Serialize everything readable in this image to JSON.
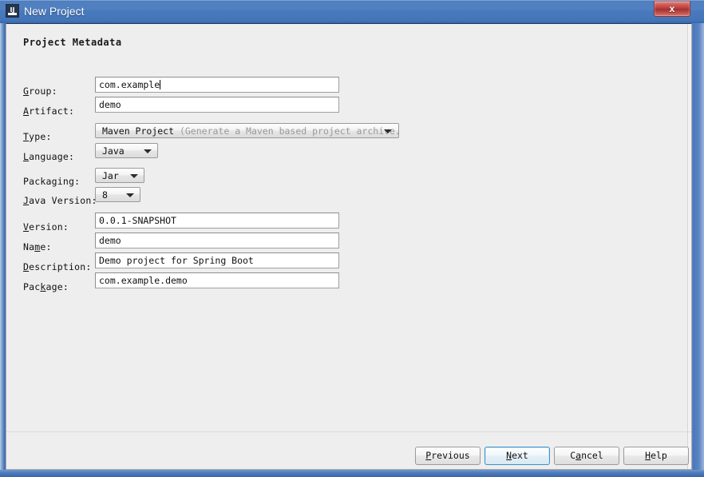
{
  "window": {
    "title": "New Project",
    "icon": "intellij-idea-icon",
    "close_label": "x",
    "titlebar_color": "#4a7abd",
    "content_bg": "#eeeeee"
  },
  "panel": {
    "heading": "Project Metadata"
  },
  "form": {
    "rows": [
      {
        "label": "Group:",
        "mnemonic": "G",
        "value": "com.example",
        "kind": "text",
        "focused": true
      },
      {
        "label": "Artifact:",
        "mnemonic": "A",
        "value": "demo",
        "kind": "text",
        "focused": false
      },
      {
        "label": "Type:",
        "mnemonic": "T",
        "value": "Maven Project",
        "hint": "(Generate a Maven based project archive.)",
        "kind": "combo"
      },
      {
        "label": "Language:",
        "mnemonic": "L",
        "value": "Java",
        "kind": "combo"
      },
      {
        "label": "Packaging:",
        "mnemonic": "",
        "value": "Jar",
        "kind": "combo"
      },
      {
        "label": "Java Version:",
        "mnemonic": "J",
        "value": "8",
        "kind": "combo"
      },
      {
        "label": "Version:",
        "mnemonic": "V",
        "value": "0.0.1-SNAPSHOT",
        "kind": "text",
        "focused": false
      },
      {
        "label": "Name:",
        "mnemonic": "m",
        "value": "demo",
        "kind": "text",
        "focused": false
      },
      {
        "label": "Description:",
        "mnemonic": "D",
        "value": "Demo project for Spring Boot",
        "kind": "text",
        "focused": false
      },
      {
        "label": "Package:",
        "mnemonic": "k",
        "value": "com.example.demo",
        "kind": "text",
        "focused": false
      }
    ],
    "labels": {
      "group_pre": "",
      "group_mn": "G",
      "group_post": "roup:",
      "artifact_pre": "",
      "artifact_mn": "A",
      "artifact_post": "rtifact:",
      "type_pre": "",
      "type_mn": "T",
      "type_post": "ype:",
      "language_pre": "",
      "language_mn": "L",
      "language_post": "anguage:",
      "packaging_full": "Packaging:",
      "javaversion_pre": "",
      "javaversion_mn": "J",
      "javaversion_post": "ava Version:",
      "version_pre": "",
      "version_mn": "V",
      "version_post": "ersion:",
      "name_pre": "Na",
      "name_mn": "m",
      "name_post": "e:",
      "description_pre": "",
      "description_mn": "D",
      "description_post": "escription:",
      "package_pre": "Pac",
      "package_mn": "k",
      "package_post": "age:"
    },
    "values": {
      "group": "com.example",
      "artifact": "demo",
      "type_main": "Maven Project",
      "type_hint": "(Generate a Maven based project archive.)",
      "language": "Java",
      "packaging": "Jar",
      "java_version": "8",
      "version": "0.0.1-SNAPSHOT",
      "name": "demo",
      "description": "Demo project for Spring Boot",
      "package": "com.example.demo"
    }
  },
  "buttons": {
    "previous": {
      "pre": "",
      "mn": "P",
      "post": "revious"
    },
    "next": {
      "pre": "",
      "mn": "N",
      "post": "ext"
    },
    "cancel": {
      "pre": "C",
      "mn": "a",
      "post": "ncel"
    },
    "help": {
      "pre": "",
      "mn": "H",
      "post": "elp"
    }
  }
}
